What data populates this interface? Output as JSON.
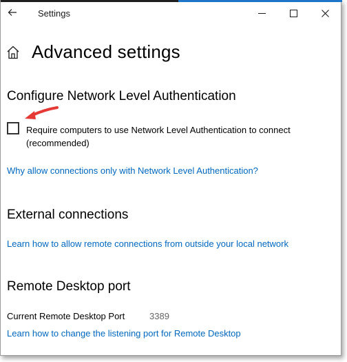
{
  "window": {
    "title": "Settings",
    "accent_color": "#1e74c9"
  },
  "icons": {
    "back": "back-arrow-icon",
    "minimize": "minimize-icon",
    "maximize": "maximize-icon",
    "close": "close-icon",
    "home": "home-icon",
    "annotation": "red-arrow-annotation"
  },
  "page": {
    "title": "Advanced settings"
  },
  "nla": {
    "heading": "Configure Network Level Authentication",
    "checkbox_label": "Require computers to use Network Level Authentication to connect (recommended)",
    "checked": false,
    "link": "Why allow connections only with Network Level Authentication?"
  },
  "external": {
    "heading": "External connections",
    "link": "Learn how to allow remote connections from outside your local network"
  },
  "port": {
    "heading": "Remote Desktop port",
    "label": "Current Remote Desktop Port",
    "value": "3389",
    "link": "Learn how to change the listening port for Remote Desktop"
  },
  "colors": {
    "link": "#0067c0",
    "annotation_arrow": "#e53935"
  }
}
